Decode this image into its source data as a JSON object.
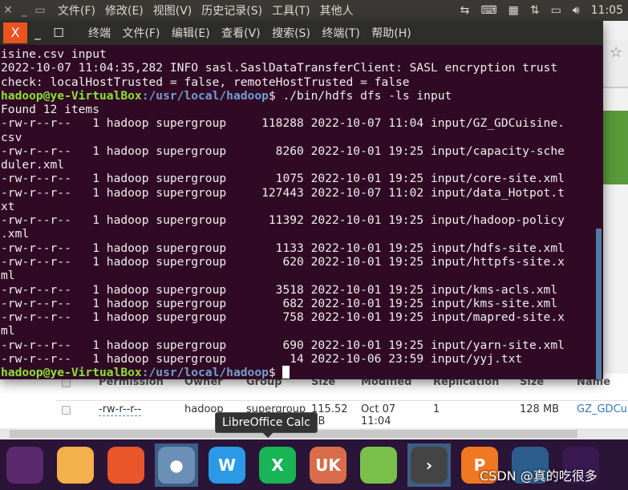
{
  "top_panel": {
    "menus": [
      "文件(F)",
      "修改(E)",
      "视图(V)",
      "历史记录(S)",
      "工具(T)",
      "其他人"
    ],
    "clock": "11:05"
  },
  "terminal": {
    "title_menus": [
      "终端",
      "文件(F)",
      "编辑(E)",
      "查看(V)",
      "搜索(S)",
      "终端(T)",
      "帮助(H)"
    ],
    "close": "X",
    "lines": [
      {
        "text": "isine.csv input"
      },
      {
        "text": "2022-10-07 11:04:35,282 INFO sasl.SaslDataTransferClient: SASL encryption trust"
      },
      {
        "text": "check: localHostTrusted = false, remoteHostTrusted = false"
      },
      {
        "user": "hadoop@ye-VirtualBox",
        "path": ":/usr/local/hadoop",
        "text": "$ ./bin/hdfs dfs -ls input"
      },
      {
        "text": "Found 12 items"
      },
      {
        "text": "-rw-r--r--   1 hadoop supergroup     118288 2022-10-07 11:04 input/GZ_GDCuisine."
      },
      {
        "text": "csv"
      },
      {
        "text": "-rw-r--r--   1 hadoop supergroup       8260 2022-10-01 19:25 input/capacity-sche"
      },
      {
        "text": "duler.xml"
      },
      {
        "text": "-rw-r--r--   1 hadoop supergroup       1075 2022-10-01 19:25 input/core-site.xml"
      },
      {
        "text": "-rw-r--r--   1 hadoop supergroup     127443 2022-10-07 11:02 input/data_Hotpot.t"
      },
      {
        "text": "xt"
      },
      {
        "text": "-rw-r--r--   1 hadoop supergroup      11392 2022-10-01 19:25 input/hadoop-policy"
      },
      {
        "text": ".xml"
      },
      {
        "text": "-rw-r--r--   1 hadoop supergroup       1133 2022-10-01 19:25 input/hdfs-site.xml"
      },
      {
        "text": "-rw-r--r--   1 hadoop supergroup        620 2022-10-01 19:25 input/httpfs-site.x"
      },
      {
        "text": "ml"
      },
      {
        "text": "-rw-r--r--   1 hadoop supergroup       3518 2022-10-01 19:25 input/kms-acls.xml"
      },
      {
        "text": "-rw-r--r--   1 hadoop supergroup        682 2022-10-01 19:25 input/kms-site.xml"
      },
      {
        "text": "-rw-r--r--   1 hadoop supergroup        758 2022-10-01 19:25 input/mapred-site.x"
      },
      {
        "text": "ml"
      },
      {
        "text": "-rw-r--r--   1 hadoop supergroup        690 2022-10-01 19:25 input/yarn-site.xml"
      },
      {
        "text": "-rw-r--r--   1 hadoop supergroup         14 2022-10-06 23:59 input/yyj.txt"
      },
      {
        "user": "hadoop@ye-VirtualBox",
        "path": ":/usr/local/hadoop",
        "text": "$ ",
        "cursor": true
      }
    ]
  },
  "browser_table": {
    "headers": [
      "Permission",
      "Owner",
      "Group",
      "Size",
      "Modified",
      "Replication",
      "Size",
      "Name"
    ],
    "row": [
      "-rw-r--r--",
      "hadoop",
      "supergroup",
      "115.52 KB",
      "Oct 07 11:04",
      "1",
      "128 MB",
      "GZ_GDCui"
    ]
  },
  "tooltip": "LibreOffice Calc",
  "dock": [
    {
      "name": "ubuntu",
      "label": "",
      "color": "#5b2a6e"
    },
    {
      "name": "files",
      "label": "",
      "color": "#f4b04a"
    },
    {
      "name": "firefox",
      "label": "",
      "color": "#e8562a"
    },
    {
      "name": "chromium",
      "label": "●",
      "color": "#6c8fb8",
      "active": true
    },
    {
      "name": "writer",
      "label": "W",
      "color": "#2a9ae6"
    },
    {
      "name": "calc",
      "label": "X",
      "color": "#18b455"
    },
    {
      "name": "ubuntu-software",
      "label": "UK",
      "color": "#d96c4a"
    },
    {
      "name": "installer",
      "label": "",
      "color": "#79c04a"
    },
    {
      "name": "terminal",
      "label": "›",
      "color": "#444",
      "active": true
    },
    {
      "name": "impress",
      "label": "P",
      "color": "#f07820"
    },
    {
      "name": "workspace",
      "label": "",
      "color": "#2c5d8c"
    },
    {
      "name": "disc",
      "label": "",
      "color": "#3a1850"
    }
  ],
  "watermark": "CSDN @真的吃很多"
}
